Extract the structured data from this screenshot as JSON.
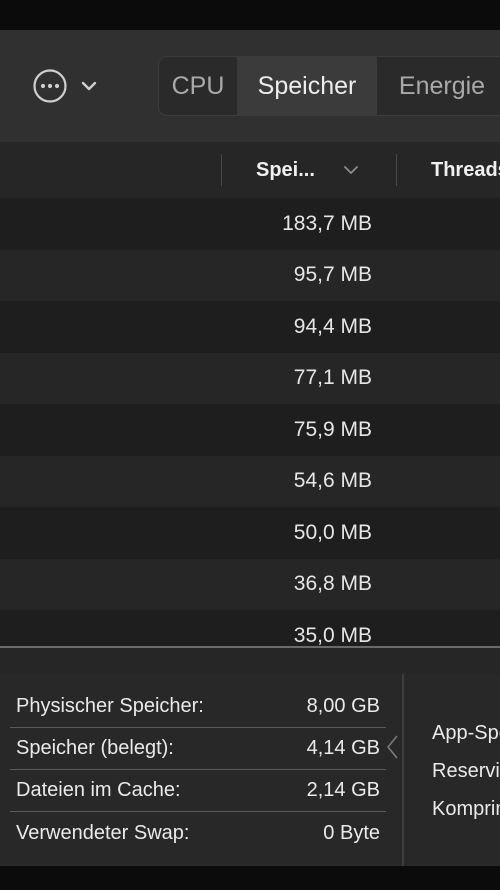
{
  "toolbar": {
    "more_icon": "ellipsis-circle-icon",
    "chevron_icon": "chevron-down-icon",
    "tabs": [
      {
        "label": "CPU",
        "active": false
      },
      {
        "label": "Speicher",
        "active": true
      },
      {
        "label": "Energie",
        "active": false
      }
    ]
  },
  "table": {
    "columns": [
      {
        "label": "Spei...",
        "sorted": true,
        "sort_icon": "chevron-down-icon"
      },
      {
        "label": "Threads"
      }
    ],
    "rows": [
      {
        "memory": "183,7 MB"
      },
      {
        "memory": "95,7 MB"
      },
      {
        "memory": "94,4 MB"
      },
      {
        "memory": "77,1 MB"
      },
      {
        "memory": "75,9 MB"
      },
      {
        "memory": "54,6 MB"
      },
      {
        "memory": "50,0 MB"
      },
      {
        "memory": "36,8 MB"
      },
      {
        "memory": "35,0 MB"
      }
    ]
  },
  "memory_stats": {
    "items": [
      {
        "label": "Physischer Speicher:",
        "value": "8,00 GB"
      },
      {
        "label": "Speicher (belegt):",
        "value": "4,14 GB"
      },
      {
        "label": "Dateien im Cache:",
        "value": "2,14 GB"
      },
      {
        "label": "Verwendeter Swap:",
        "value": "0 Byte"
      }
    ],
    "right_labels": [
      "App-Speicher:",
      "Reserviert:",
      "Komprimiert:"
    ]
  },
  "colors": {
    "background": "#303030",
    "row_odd": "#1e1e1e",
    "row_even": "#262626",
    "text": "#e6e6e6"
  }
}
